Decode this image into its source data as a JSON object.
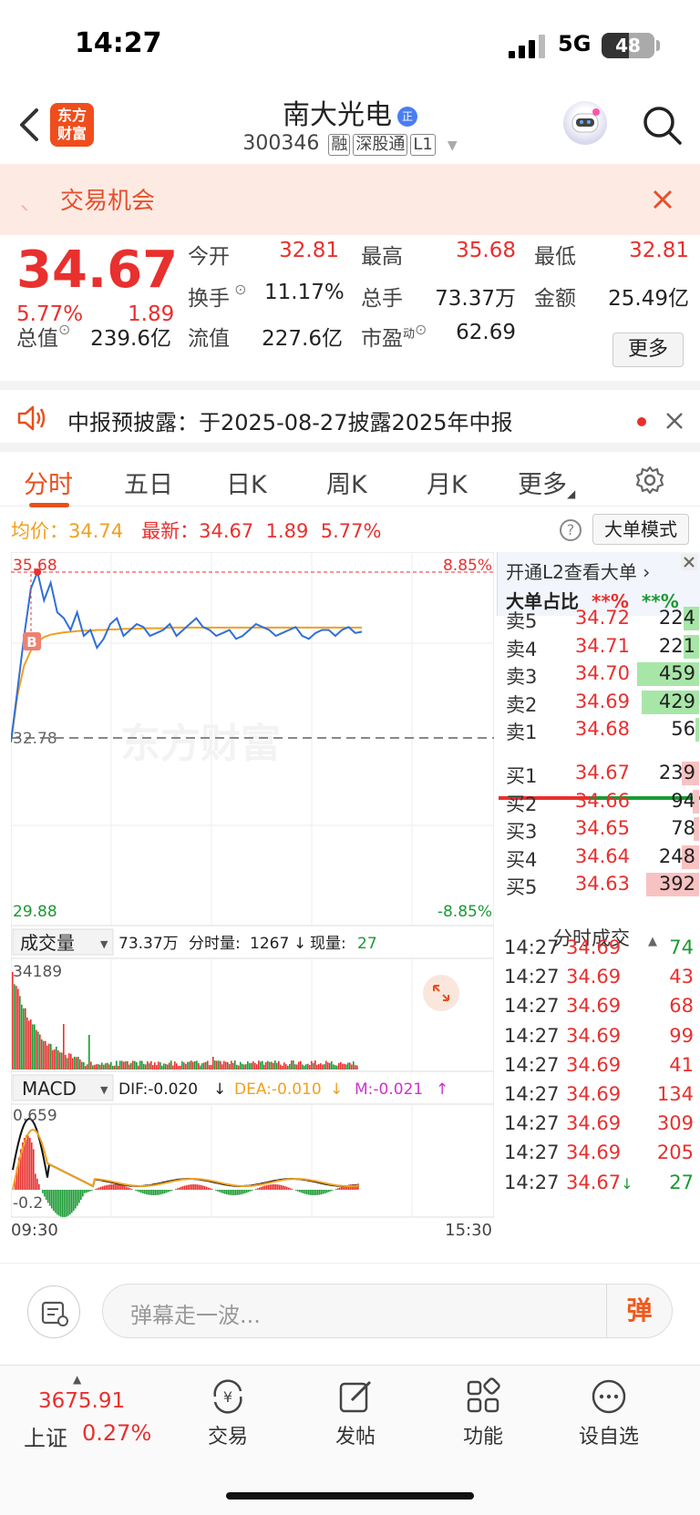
{
  "status": {
    "time": "14:27",
    "network": "5G",
    "battery": "48"
  },
  "header": {
    "logo_line1": "东方",
    "logo_line2": "财富",
    "name": "南大光电",
    "name_badge": "正",
    "code": "300346",
    "tags": [
      "融",
      "深股通",
      "L1"
    ]
  },
  "banner": {
    "text": "交易机会"
  },
  "quote": {
    "price": "34.67",
    "change_pct": "5.77%",
    "change": "1.89",
    "open_label": "今开",
    "open": "32.81",
    "high_label": "最高",
    "high": "35.68",
    "low_label": "最低",
    "low": "32.81",
    "turnover_label": "换手",
    "turnover": "11.17%",
    "volume_label": "总手",
    "volume": "73.37万",
    "amount_label": "金额",
    "amount": "25.49亿",
    "mktcap_label": "总值",
    "mktcap": "239.6亿",
    "float_label": "流值",
    "float": "227.6亿",
    "pe_label": "市盈",
    "pe_sup": "动",
    "pe": "62.69",
    "more": "更多"
  },
  "notice": {
    "text": "中报预披露：于2025-08-27披露2025年中报"
  },
  "tabs": [
    "分时",
    "五日",
    "日K",
    "周K",
    "月K",
    "更多"
  ],
  "info": {
    "avg_label": "均价：",
    "avg": "34.74",
    "latest_label": "最新：",
    "latest": "34.67",
    "change": "1.89",
    "pct": "5.77%",
    "big_order_mode": "大单模式"
  },
  "chart_data": {
    "type": "line",
    "y_max": 35.68,
    "y_ref": 32.78,
    "y_min": 29.88,
    "y_max_label": "35.68",
    "y_ref_label": "32.78",
    "y_min_label": "29.88",
    "pct_max_label": "8.85%",
    "pct_min_label": "-8.85%",
    "marker": "B",
    "watermark": "东方财富",
    "price_series": [
      32.8,
      33.7,
      34.6,
      35.4,
      35.68,
      35.2,
      35.5,
      35.0,
      34.9,
      34.7,
      35.0,
      34.6,
      34.7,
      34.4,
      34.55,
      34.8,
      34.9,
      34.6,
      34.7,
      34.8,
      34.75,
      34.6,
      34.65,
      34.7,
      34.8,
      34.6,
      34.7,
      34.8,
      34.9,
      34.75,
      34.7,
      34.6,
      34.65,
      34.7,
      34.55,
      34.6,
      34.7,
      34.8,
      34.75,
      34.7,
      34.6,
      34.65,
      34.7,
      34.75,
      34.6,
      34.55,
      34.65,
      34.7,
      34.7,
      34.6,
      34.7,
      34.75,
      34.65,
      34.67
    ],
    "avg_series": [
      32.8,
      33.6,
      34.1,
      34.35,
      34.5,
      34.58,
      34.62,
      34.64,
      34.66,
      34.67,
      34.68,
      34.69,
      34.69,
      34.7,
      34.7,
      34.71,
      34.71,
      34.72,
      34.72,
      34.72,
      34.73,
      34.73,
      34.73,
      34.73,
      34.74,
      34.74,
      34.74,
      34.74,
      34.74,
      34.74,
      34.74,
      34.74,
      34.74,
      34.74,
      34.74,
      34.74,
      34.74,
      34.74,
      34.74,
      34.74,
      34.74,
      34.74,
      34.74,
      34.74,
      34.74,
      34.74,
      34.74,
      34.74,
      34.74,
      34.74,
      34.74,
      34.74,
      34.74,
      34.74
    ],
    "volume_header": {
      "label": "成交量",
      "total": "73.37万",
      "minute_label": "分时量:",
      "minute": "1267",
      "now_label": "现量:",
      "now": "27"
    },
    "volume_max_label": "34189",
    "macd_header": {
      "label": "MACD",
      "dif": "DIF:-0.020",
      "dea": "DEA:-0.010",
      "m": "M:-0.021"
    },
    "macd_max_label": "0.659",
    "macd_min_label": "-0.2",
    "x_start": "09:30",
    "x_end": "15:30"
  },
  "orderbook": {
    "promo": "开通L2查看大单",
    "ratio_label": "大单占比",
    "ratio_buy": "**%",
    "ratio_sell": "**%",
    "asks": [
      {
        "label": "卖5",
        "price": "34.72",
        "vol": "224",
        "bar": 0.24
      },
      {
        "label": "卖4",
        "price": "34.71",
        "vol": "221",
        "bar": 0.24
      },
      {
        "label": "卖3",
        "price": "34.70",
        "vol": "459",
        "bar": 0.95
      },
      {
        "label": "卖2",
        "price": "34.69",
        "vol": "429",
        "bar": 0.88
      },
      {
        "label": "卖1",
        "price": "34.68",
        "vol": "56",
        "bar": 0.06
      }
    ],
    "bids": [
      {
        "label": "买1",
        "price": "34.67",
        "vol": "239",
        "bar": 0.26
      },
      {
        "label": "买2",
        "price": "34.66",
        "vol": "94",
        "bar": 0.1
      },
      {
        "label": "买3",
        "price": "34.65",
        "vol": "78",
        "bar": 0.09
      },
      {
        "label": "买4",
        "price": "34.64",
        "vol": "248",
        "bar": 0.27
      },
      {
        "label": "买5",
        "price": "34.63",
        "vol": "392",
        "bar": 0.8
      }
    ],
    "trades_header": "分时成交",
    "trades": [
      {
        "time": "14:27",
        "price": "34.69",
        "vol": "74",
        "color": "green"
      },
      {
        "time": "14:27",
        "price": "34.69",
        "vol": "43",
        "color": "red"
      },
      {
        "time": "14:27",
        "price": "34.69",
        "vol": "68",
        "color": "red"
      },
      {
        "time": "14:27",
        "price": "34.69",
        "vol": "99",
        "color": "red"
      },
      {
        "time": "14:27",
        "price": "34.69",
        "vol": "41",
        "color": "red"
      },
      {
        "time": "14:27",
        "price": "34.69",
        "vol": "134",
        "color": "red"
      },
      {
        "time": "14:27",
        "price": "34.69",
        "vol": "309",
        "color": "red"
      },
      {
        "time": "14:27",
        "price": "34.69",
        "vol": "205",
        "color": "red"
      },
      {
        "time": "14:27",
        "price": "34.67",
        "vol": "27",
        "color": "green",
        "arrow": "↓"
      }
    ]
  },
  "danmu": {
    "placeholder": "弹幕走一波...",
    "send": "弹"
  },
  "bottom": {
    "index_value": "3675.91",
    "index_name": "上证",
    "index_pct": "0.27%",
    "nav": [
      "交易",
      "发帖",
      "功能",
      "设自选"
    ]
  }
}
